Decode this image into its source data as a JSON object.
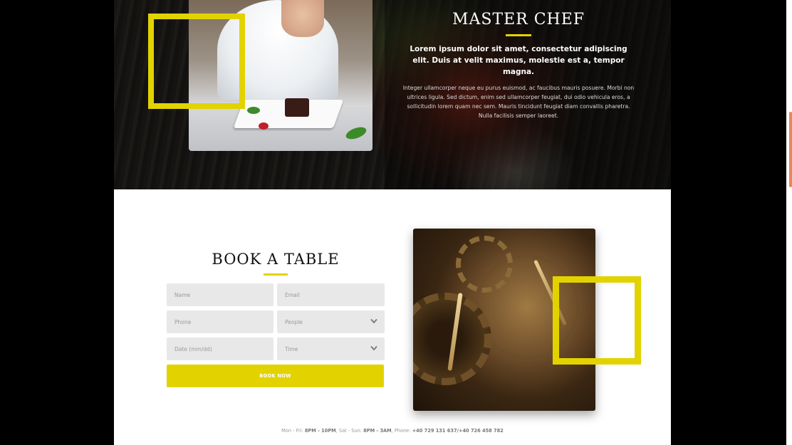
{
  "hero": {
    "title": "MASTER CHEF",
    "lead": "Lorem ipsum dolor sit amet, consectetur adipiscing elit. Duis at velit maximus, molestie est a, tempor magna.",
    "body": "Integer ullamcorper neque eu purus euismod, ac faucibus mauris posuere. Morbi non ultrices ligula. Sed dictum, enim sed ullamcorper feugiat, dui odio vehicula eros, a sollicitudin lorem quam nec sem. Mauris tincidunt feugiat diam convallis pharetra. Nulla facilisis semper laoreet."
  },
  "booking": {
    "title": "BOOK A TABLE",
    "name_placeholder": "Name",
    "email_placeholder": "Email",
    "phone_placeholder": "Phone",
    "people_placeholder": "People",
    "date_placeholder": "Date (mm/dd)",
    "time_placeholder": "Time",
    "submit_label": "BOOK NOW"
  },
  "hours": {
    "weekday_label": "Mon - Fri: ",
    "weekday_time": "8PM - 10PM",
    "weekend_label": ", Sat - Sun: ",
    "weekend_time": "8PM - 3AM",
    "phone_label": ", Phone: ",
    "phone_numbers": "+40 729 131 637/+40 726 458 782"
  },
  "colors": {
    "accent": "#e2d300",
    "field_bg": "#e8e8e8",
    "scroll_thumb": "#e8875a"
  },
  "icons": {
    "select_caret": "chevron-down-icon"
  }
}
